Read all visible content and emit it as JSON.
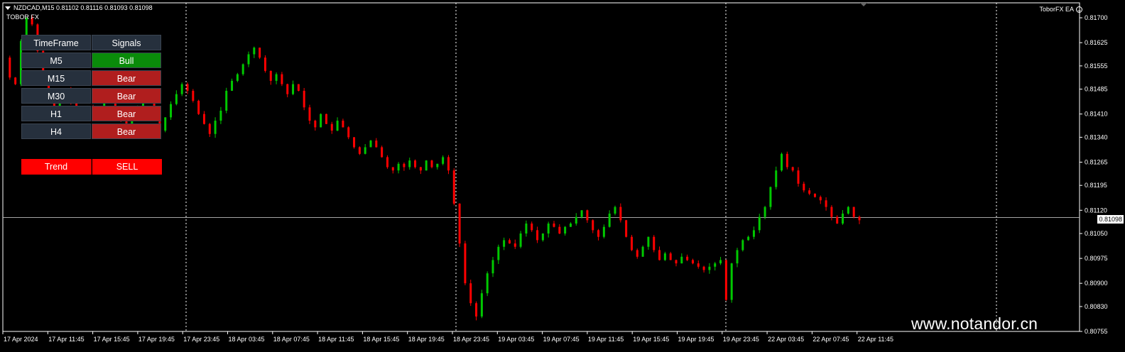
{
  "header": {
    "symbol_line": "NZDCAD,M15  0.81102 0.81116 0.81093 0.81098",
    "indicator_name": "TOBOR FX",
    "ea_name": "ToborFX EA"
  },
  "signals_panel": {
    "col_timeframe": "TimeFrame",
    "col_signals": "Signals",
    "rows": [
      {
        "tf": "M5",
        "signal": "Bull"
      },
      {
        "tf": "M15",
        "signal": "Bear"
      },
      {
        "tf": "M30",
        "signal": "Bear"
      },
      {
        "tf": "H1",
        "signal": "Bear"
      },
      {
        "tf": "H4",
        "signal": "Bear"
      }
    ],
    "trend_label": "Trend",
    "trend_value": "SELL"
  },
  "current_price": "0.81098",
  "price_axis": [
    "0.81700",
    "0.81625",
    "0.81555",
    "0.81485",
    "0.81410",
    "0.81340",
    "0.81265",
    "0.81195",
    "0.81120",
    "0.81050",
    "0.80975",
    "0.80900",
    "0.80830",
    "0.80755"
  ],
  "time_axis": [
    "17 Apr 2024",
    "17 Apr 11:45",
    "17 Apr 15:45",
    "17 Apr 19:45",
    "17 Apr 23:45",
    "18 Apr 03:45",
    "18 Apr 07:45",
    "18 Apr 11:45",
    "18 Apr 15:45",
    "18 Apr 19:45",
    "18 Apr 23:45",
    "19 Apr 03:45",
    "19 Apr 07:45",
    "19 Apr 11:45",
    "19 Apr 15:45",
    "19 Apr 19:45",
    "19 Apr 23:45",
    "22 Apr 03:45",
    "22 Apr 07:45",
    "22 Apr 11:45"
  ],
  "watermark": "www.notandor.cn",
  "colors": {
    "bull": "#00c800",
    "bear": "#ff0000",
    "background": "#000000",
    "grid": "#ffffff"
  },
  "chart_data": {
    "type": "line",
    "ylim": [
      0.80755,
      0.81745
    ],
    "series": [
      {
        "values": [
          0.8158,
          0.8152,
          0.815,
          0.8163,
          0.817,
          0.8168,
          0.816,
          0.8152,
          0.8145,
          0.8143,
          0.8146,
          0.8148,
          0.8145,
          0.8142,
          0.814,
          0.8143,
          0.814,
          0.8142,
          0.8146,
          0.8148,
          0.8142,
          0.8139,
          0.8137,
          0.8141,
          0.8143,
          0.8147,
          0.8145,
          0.8142,
          0.8136,
          0.814,
          0.8144,
          0.8147,
          0.815,
          0.8148,
          0.8145,
          0.8141,
          0.8138,
          0.8135,
          0.8139,
          0.8142,
          0.8148,
          0.8151,
          0.8153,
          0.8156,
          0.8159,
          0.8161,
          0.8158,
          0.8154,
          0.8151,
          0.8153,
          0.815,
          0.8147,
          0.815,
          0.8148,
          0.8143,
          0.8139,
          0.8137,
          0.8141,
          0.8138,
          0.8136,
          0.8139,
          0.8137,
          0.8134,
          0.8131,
          0.8129,
          0.8131,
          0.8133,
          0.8131,
          0.8128,
          0.8125,
          0.8124,
          0.8126,
          0.8125,
          0.8127,
          0.8125,
          0.8124,
          0.8127,
          0.8125,
          0.8126,
          0.8128,
          0.8124,
          0.8114,
          0.8102,
          0.809,
          0.8084,
          0.808,
          0.8087,
          0.8093,
          0.8097,
          0.8101,
          0.8103,
          0.8102,
          0.8101,
          0.8105,
          0.8108,
          0.8106,
          0.8103,
          0.8105,
          0.8108,
          0.8107,
          0.8105,
          0.8107,
          0.8108,
          0.811,
          0.8112,
          0.8109,
          0.8106,
          0.8104,
          0.8107,
          0.8111,
          0.8113,
          0.8109,
          0.8104,
          0.81,
          0.8098,
          0.8101,
          0.8104,
          0.81,
          0.8097,
          0.8099,
          0.8097,
          0.8096,
          0.8098,
          0.8097,
          0.8096,
          0.8095,
          0.8094,
          0.8095,
          0.8096,
          0.8097,
          0.8085,
          0.8096,
          0.81,
          0.8103,
          0.8104,
          0.8106,
          0.811,
          0.8113,
          0.8119,
          0.8124,
          0.8129,
          0.8125,
          0.8124,
          0.812,
          0.8118,
          0.8117,
          0.8116,
          0.8115,
          0.8113,
          0.811,
          0.8108,
          0.8111,
          0.8113,
          0.811,
          0.8109
        ]
      }
    ]
  }
}
